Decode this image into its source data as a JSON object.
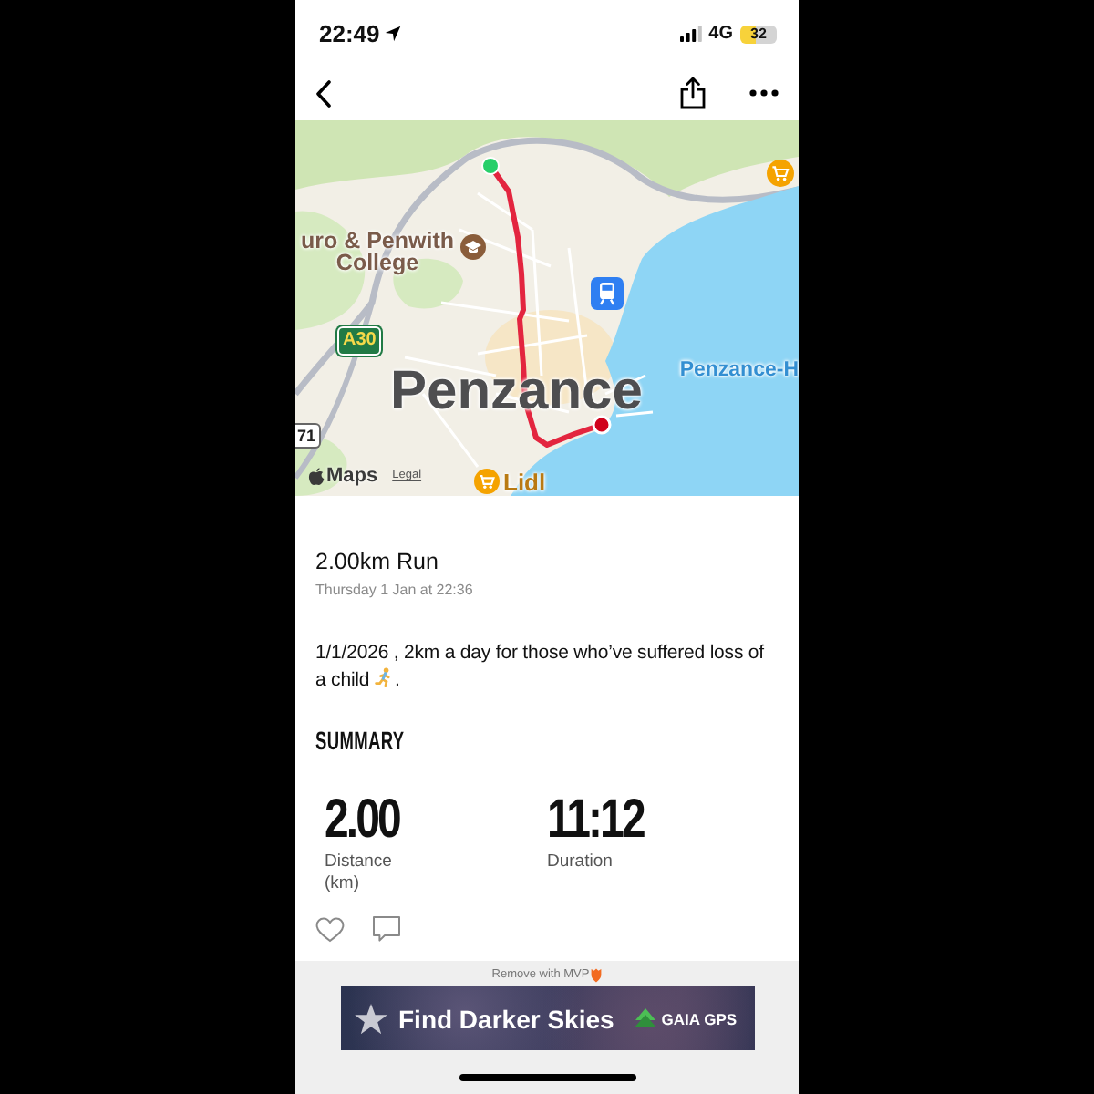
{
  "status_bar": {
    "time": "22:49",
    "network": "4G",
    "battery": "32"
  },
  "map": {
    "labels": [
      {
        "kind": "area",
        "text": "uro & Penwith College"
      },
      {
        "kind": "road",
        "text": "A30"
      },
      {
        "kind": "road_edge",
        "text": "71"
      },
      {
        "kind": "city",
        "text": "Penzance"
      },
      {
        "kind": "water",
        "text": "Penzance-H"
      },
      {
        "kind": "shop",
        "text": "Lidl"
      }
    ],
    "attribution": {
      "brand": "Maps",
      "legal": "Legal"
    }
  },
  "activity": {
    "title": "2.00km Run",
    "date": "Thursday 1 Jan at 22:36",
    "description": "1/1/2026 , 2km a day for those who’ve suffered loss of a child",
    "description_end": "."
  },
  "summary": {
    "heading": "SUMMARY",
    "stats": [
      {
        "value": "2.00",
        "label": "Distance (km)"
      },
      {
        "value": "11:12",
        "label": "Duration"
      }
    ]
  },
  "ad": {
    "remove_link": "Remove with MVP",
    "headline": "Find Darker Skies",
    "brand": "GAIA GPS"
  }
}
